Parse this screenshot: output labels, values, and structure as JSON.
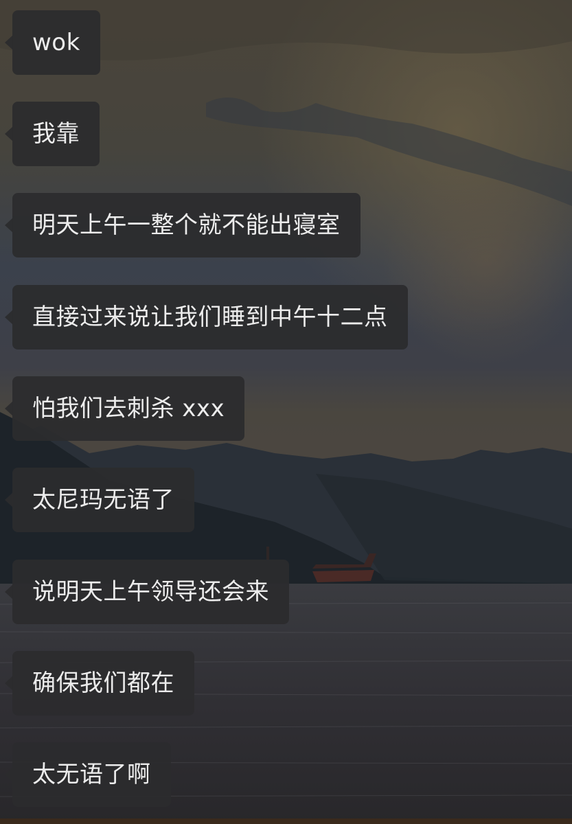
{
  "messages": [
    {
      "text": "wok"
    },
    {
      "text": "我靠"
    },
    {
      "text": "明天上午一整个就不能出寝室"
    },
    {
      "text": "直接过来说让我们睡到中午十二点"
    },
    {
      "text": "怕我们去刺杀 xxx"
    },
    {
      "text": "太尼玛无语了"
    },
    {
      "text": "说明天上午领导还会来"
    },
    {
      "text": "确保我们都在"
    },
    {
      "text": "太无语了啊"
    }
  ],
  "colors": {
    "bubble": "#2c2c2e",
    "bubble_text": "#ececec",
    "sky_top": "#4a4438",
    "sky_mid": "#3c4250",
    "sea": "#2e3036",
    "mountains": "#1f262c"
  }
}
